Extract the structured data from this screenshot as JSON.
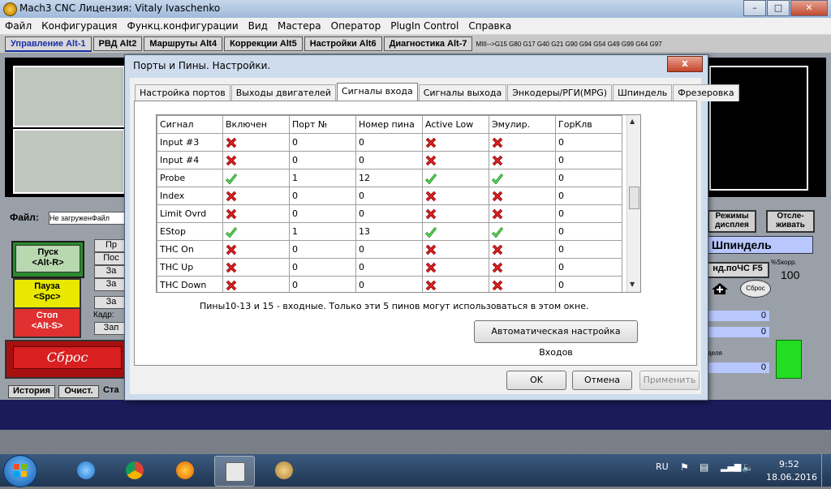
{
  "window": {
    "title": "Mach3 CNC  Лицензия: Vitaly Ivaschenko"
  },
  "menu": [
    "Файл",
    "Конфигурация",
    "Функц.конфигурации",
    "Вид",
    "Мастера",
    "Оператор",
    "PlugIn Control",
    "Справка"
  ],
  "mach_tabs": [
    "Управление Alt-1",
    "РВД Alt2",
    "Маршруты Alt4",
    "Коррекции Alt5",
    "Настройки Alt6",
    "Диагностика Alt-7"
  ],
  "gcodes": "MIII-->G15  G80 G17 G40 G21 G90 G94 G54 G49 G99 G64 G97",
  "mach": {
    "file_label": "Файл:",
    "file_value": "Не загруженФайл",
    "start": "Пуск\n<Alt-R>",
    "pause": "Пауза\n<Spc>",
    "stop": "Стоп\n<Alt-S>",
    "reset": "Сброс",
    "frame_label": "Кадр:",
    "history": "История",
    "clear": "Очист.",
    "status_label": "Ста",
    "display_mode": "Режимы\nдисплея",
    "track": "Отсле-\nживать",
    "spindle": "Шпиндель",
    "spindle_cw": "нд.поЧС F5",
    "sro_label": "Sкорр.",
    "sro_prefix": "%",
    "sro_value": "100",
    "sbros_small": "Сброс",
    "val1": "0",
    "val2": "0",
    "val3": "0",
    "label_spindle_speed": "деля",
    "partial_buttons": [
      "Пр",
      "Пос",
      "За",
      "За",
      "За",
      "Зап"
    ]
  },
  "dialog": {
    "title": "Порты и Пины.  Настройки.",
    "close": "x",
    "tabs": [
      "Настройка портов",
      "Выходы двигателей",
      "Сигналы входа",
      "Сигналы выхода",
      "Энкодеры/РГИ(MPG)",
      "Шпиндель",
      "Фрезеровка"
    ],
    "active_tab": "Сигналы входа",
    "columns": [
      "Сигнал",
      "Включен",
      "Порт №",
      "Номер пина",
      "Active Low",
      "Эмулир.",
      "ГорКлв"
    ],
    "rows": [
      {
        "signal": "Input #3",
        "enabled": false,
        "port": "0",
        "pin": "0",
        "active_low": false,
        "emulated": false,
        "hotkey": "0"
      },
      {
        "signal": "Input #4",
        "enabled": false,
        "port": "0",
        "pin": "0",
        "active_low": false,
        "emulated": false,
        "hotkey": "0"
      },
      {
        "signal": "Probe",
        "enabled": true,
        "port": "1",
        "pin": "12",
        "active_low": true,
        "emulated": true,
        "hotkey": "0"
      },
      {
        "signal": "Index",
        "enabled": false,
        "port": "0",
        "pin": "0",
        "active_low": false,
        "emulated": false,
        "hotkey": "0"
      },
      {
        "signal": "Limit Ovrd",
        "enabled": false,
        "port": "0",
        "pin": "0",
        "active_low": false,
        "emulated": false,
        "hotkey": "0"
      },
      {
        "signal": "EStop",
        "enabled": true,
        "port": "1",
        "pin": "13",
        "active_low": true,
        "emulated": true,
        "hotkey": "0"
      },
      {
        "signal": "THC On",
        "enabled": false,
        "port": "0",
        "pin": "0",
        "active_low": false,
        "emulated": false,
        "hotkey": "0"
      },
      {
        "signal": "THC Up",
        "enabled": false,
        "port": "0",
        "pin": "0",
        "active_low": false,
        "emulated": false,
        "hotkey": "0"
      },
      {
        "signal": "THC Down",
        "enabled": false,
        "port": "0",
        "pin": "0",
        "active_low": false,
        "emulated": false,
        "hotkey": "0"
      }
    ],
    "hint": "Пины10-13 и 15 - входные. Только эти 5 пинов могут использоваться в этом окне.",
    "auto_config": "Автоматическая настройка Входов",
    "ok": "OK",
    "cancel": "Отмена",
    "apply": "Применить"
  },
  "taskbar": {
    "lang": "RU",
    "time": "9:52",
    "date": "18.06.2016"
  },
  "colors": {
    "check": "#3cc43c",
    "cross": "#d01818",
    "dialog_frame": "#cfdced",
    "accent": "#1a2ea8"
  }
}
